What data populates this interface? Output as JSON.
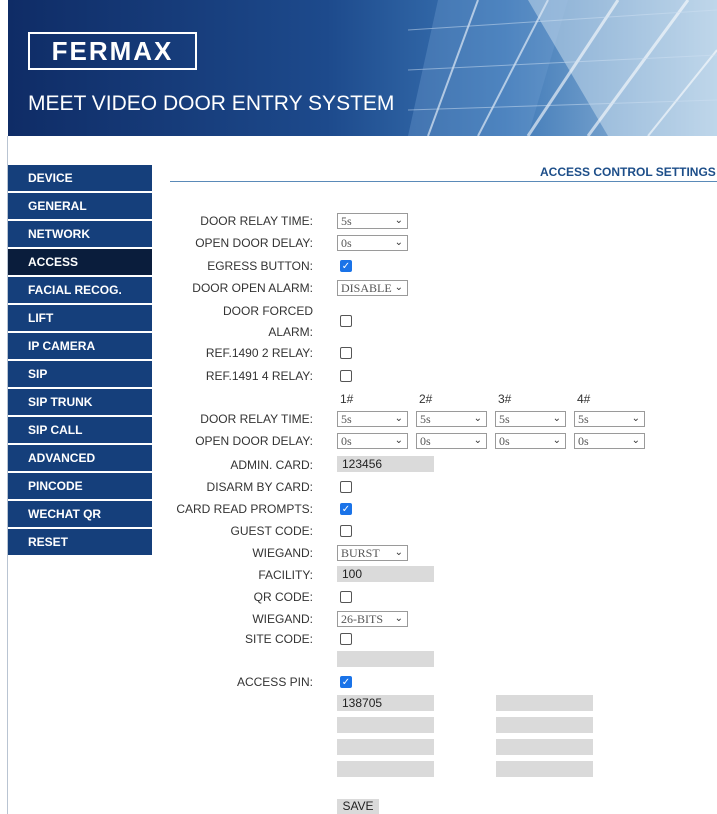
{
  "header": {
    "logo": "FERMAX",
    "title": "MEET VIDEO DOOR ENTRY SYSTEM"
  },
  "nav": [
    "DEVICE",
    "GENERAL",
    "NETWORK",
    "ACCESS",
    "FACIAL RECOG.",
    "LIFT",
    "IP CAMERA",
    "SIP",
    "SIP TRUNK",
    "SIP CALL",
    "ADVANCED",
    "PINCODE",
    "WECHAT QR",
    "RESET"
  ],
  "nav_active": "ACCESS",
  "page_title": "ACCESS CONTROL SETTINGS",
  "form": {
    "door_relay_time_label": "DOOR RELAY TIME:",
    "door_relay_time": "5s",
    "open_door_delay_label": "OPEN DOOR DELAY:",
    "open_door_delay": "0s",
    "egress_button_label": "EGRESS BUTTON:",
    "egress_button": true,
    "door_open_alarm_label": "DOOR OPEN ALARM:",
    "door_open_alarm": "DISABLE",
    "door_forced_alarm_label_1": "DOOR FORCED",
    "door_forced_alarm_label_2": "ALARM:",
    "door_forced_alarm": false,
    "ref1490_label": "REF.1490 2 RELAY:",
    "ref1490": false,
    "ref1491_label": "REF.1491 4 RELAY:",
    "ref1491": false,
    "relay_columns": [
      "1#",
      "2#",
      "3#",
      "4#"
    ],
    "relay_times_label": "DOOR RELAY TIME:",
    "relay_times": [
      "5s",
      "5s",
      "5s",
      "5s"
    ],
    "relay_delays_label": "OPEN DOOR DELAY:",
    "relay_delays": [
      "0s",
      "0s",
      "0s",
      "0s"
    ],
    "admin_card_label": "ADMIN. CARD:",
    "admin_card": "123456",
    "disarm_by_card_label": "DISARM BY CARD:",
    "disarm_by_card": false,
    "card_read_prompts_label": "CARD READ PROMPTS:",
    "card_read_prompts": true,
    "guest_code_label": "GUEST CODE:",
    "guest_code": false,
    "wiegand_label": "WIEGAND:",
    "wiegand": "BURST",
    "facility_label": "FACILITY:",
    "facility": "100",
    "qr_code_label": "QR CODE:",
    "qr_code": false,
    "wiegand2_label": "WIEGAND:",
    "wiegand2": "26-BITS",
    "site_code_label": "SITE CODE:",
    "site_code": false,
    "site_code_value": "",
    "access_pin_label": "ACCESS PIN:",
    "access_pin": true,
    "pins": [
      "138705",
      "",
      "",
      "",
      "",
      "",
      "",
      ""
    ],
    "save_label": "SAVE"
  },
  "colors": {
    "nav_bg": "#153f7b",
    "nav_active_bg": "#0a1d3c",
    "title": "#1d4e89",
    "checkbox_on": "#1a73e8"
  },
  "icons": {
    "select_arrow": "chevron-down-icon",
    "checkbox_check": "check-icon"
  }
}
